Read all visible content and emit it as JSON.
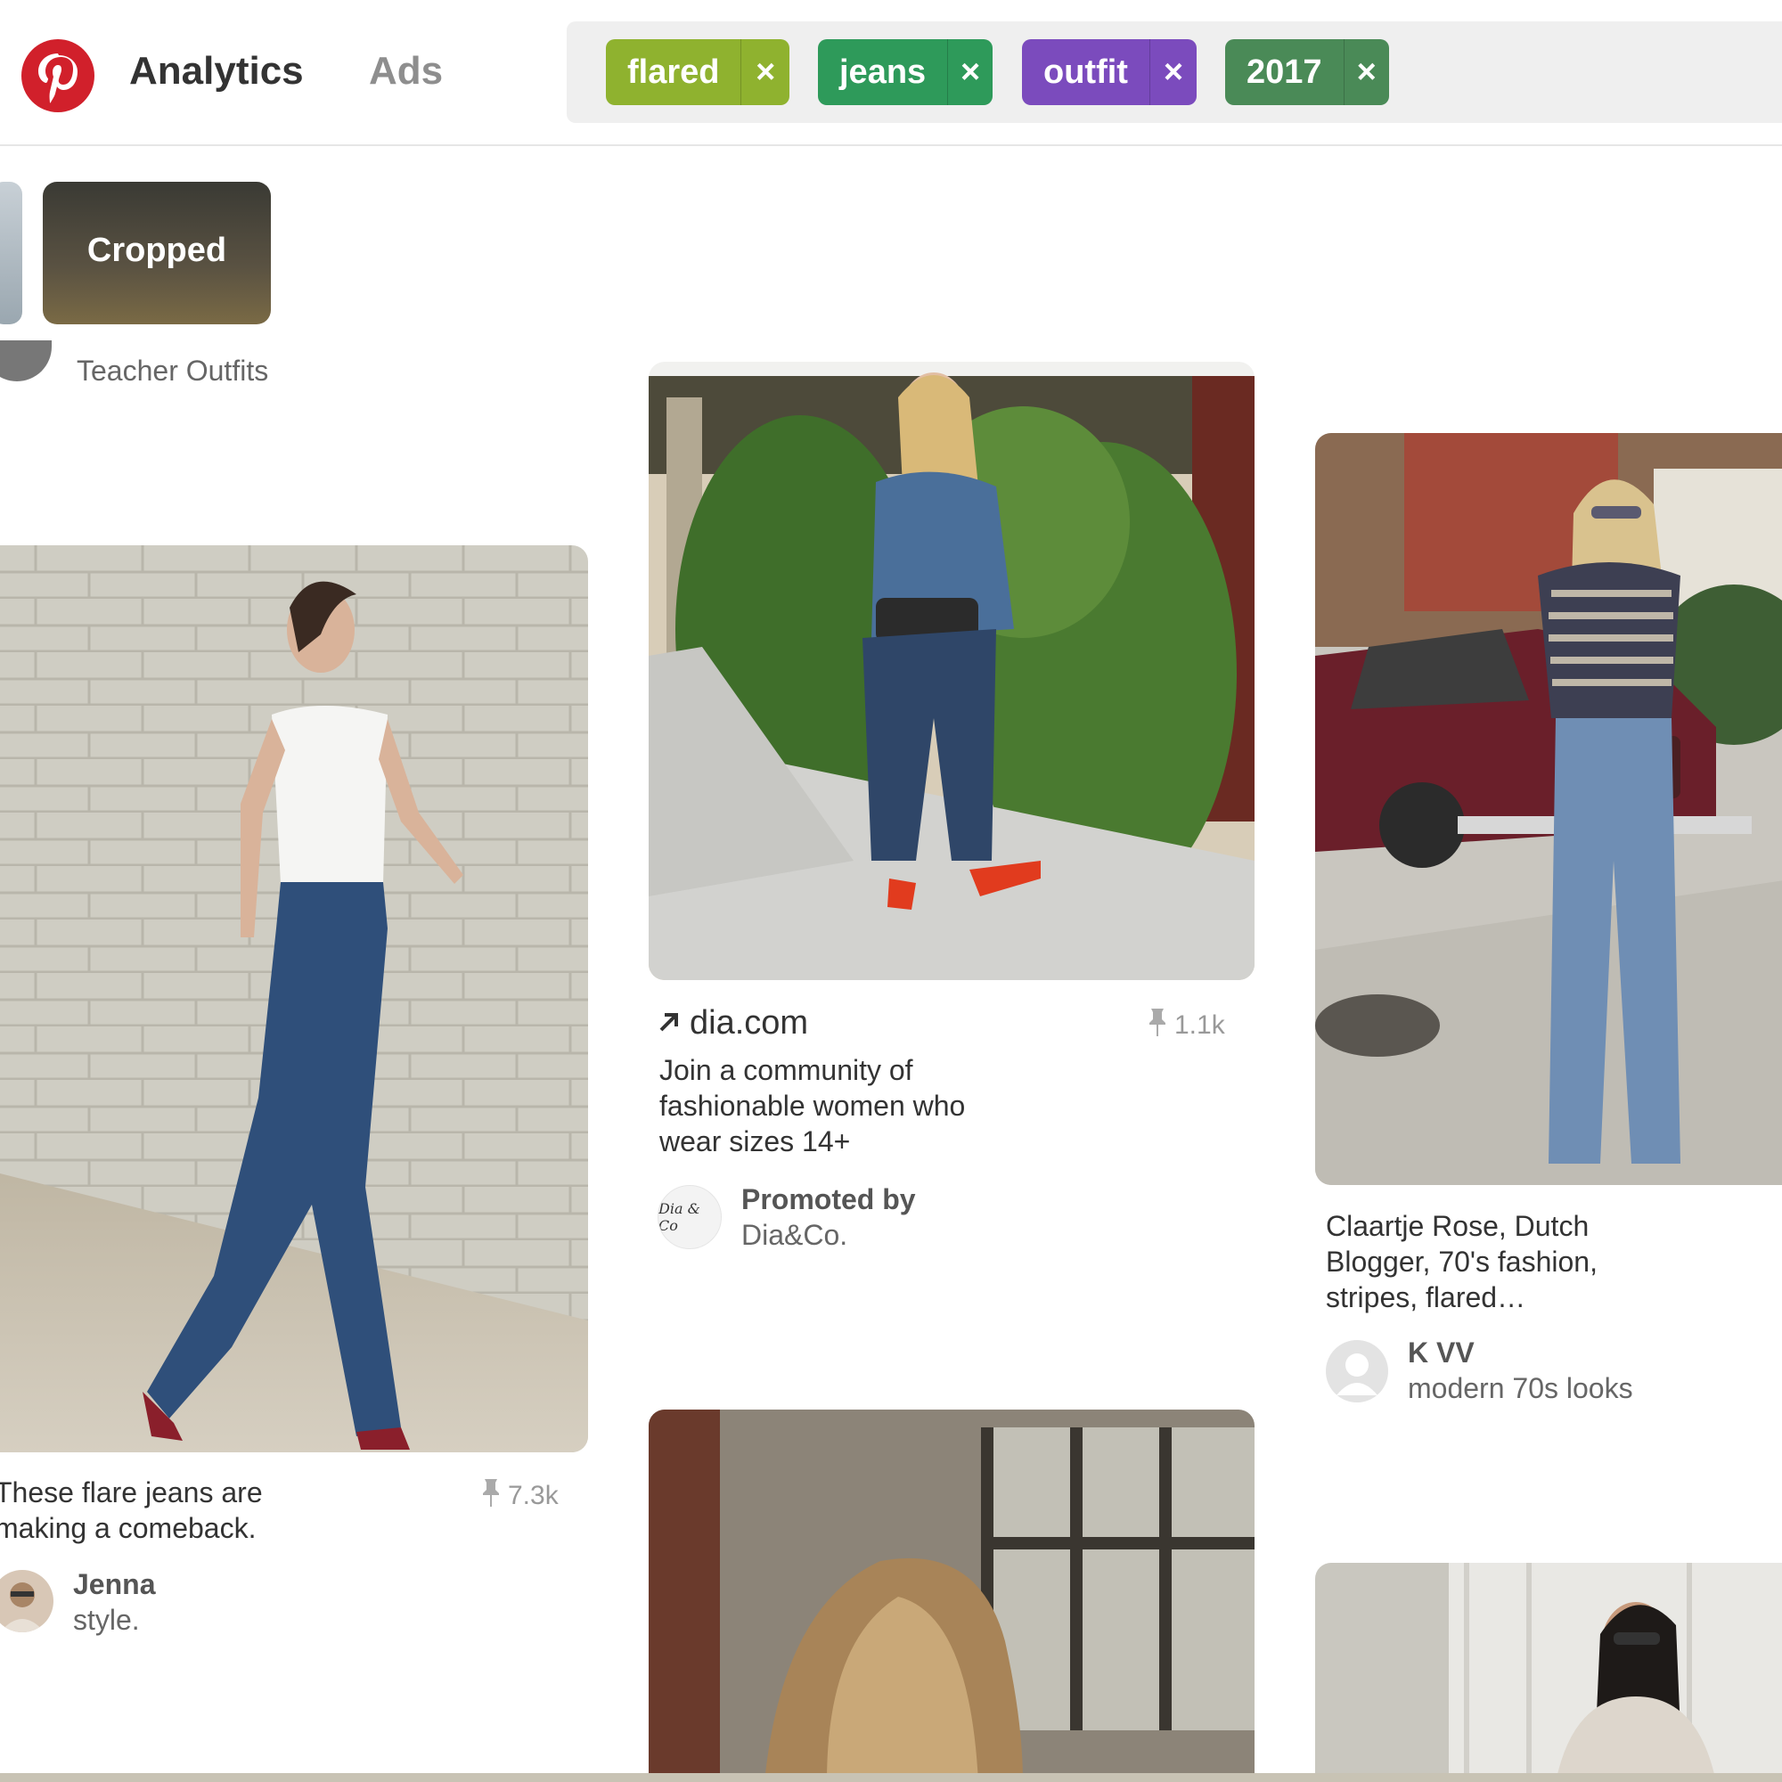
{
  "header": {
    "analytics_label": "Analytics",
    "ads_label": "Ads",
    "chips": [
      {
        "label": "flared",
        "color": "#8fb22f",
        "remove": "×"
      },
      {
        "label": "jeans",
        "color": "#2e9a5a",
        "remove": "×"
      },
      {
        "label": "outfit",
        "color": "#7b4bbd",
        "remove": "×"
      },
      {
        "label": "2017",
        "color": "#4a8a57",
        "remove": "×"
      }
    ]
  },
  "guide": {
    "label": "Cropped"
  },
  "column1": {
    "prev_board": "Teacher Outfits",
    "pin1": {
      "description_line1": "These flare jeans are",
      "description_line2": "making a comeback.",
      "saves": "7.3k",
      "user": "Jenna",
      "board": "style."
    }
  },
  "column2": {
    "pin1": {
      "domain": "dia.com",
      "saves": "1.1k",
      "description_line1": "Join a community of",
      "description_line2": "fashionable women who",
      "description_line3": "wear sizes 14+",
      "promoted_label": "Promoted by",
      "advertiser": "Dia&Co.",
      "advertiser_logo_text": "Dia & Co"
    }
  },
  "column3": {
    "pin1": {
      "description_line1": "Claartje Rose, Dutch",
      "description_line2": "Blogger, 70's fashion,",
      "description_line3": "stripes, flared…",
      "user": "K VV",
      "board": "modern 70s looks"
    }
  }
}
